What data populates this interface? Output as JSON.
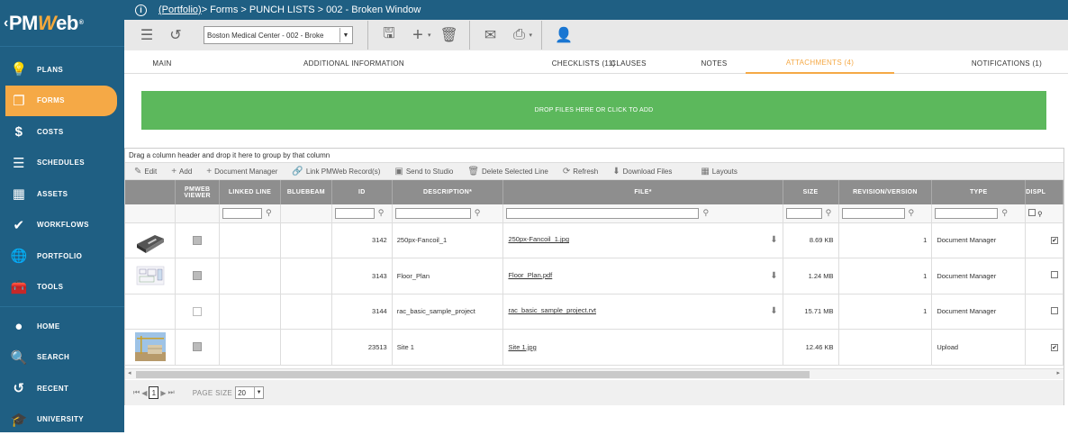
{
  "sidebar": {
    "logo": "PMWeb",
    "items": [
      {
        "label": "PLANS",
        "icon": "lightbulb-icon",
        "active": false
      },
      {
        "label": "FORMS",
        "icon": "forms-icon",
        "active": true
      },
      {
        "label": "COSTS",
        "icon": "dollar-icon",
        "active": false
      },
      {
        "label": "SCHEDULES",
        "icon": "schedule-icon",
        "active": false
      },
      {
        "label": "ASSETS",
        "icon": "building-icon",
        "active": false
      },
      {
        "label": "WORKFLOWS",
        "icon": "checkmark-icon",
        "active": false
      },
      {
        "label": "PORTFOLIO",
        "icon": "globe-icon",
        "active": false
      },
      {
        "label": "TOOLS",
        "icon": "toolbox-icon",
        "active": false
      },
      {
        "label": "HOME",
        "icon": "avatar-icon",
        "active": false
      },
      {
        "label": "SEARCH",
        "icon": "search-icon",
        "active": false
      },
      {
        "label": "RECENT",
        "icon": "history-icon",
        "active": false
      },
      {
        "label": "UNIVERSITY",
        "icon": "graduation-cap-icon",
        "active": false
      }
    ]
  },
  "breadcrumb": {
    "portfolio": "(Portfolio)",
    "rest": " > Forms > PUNCH LISTS > 002 - Broken Window"
  },
  "toolbar": {
    "record_select": "Boston Medical Center - 002 - Broke"
  },
  "tabs": [
    {
      "label": "MAIN",
      "active": false
    },
    {
      "label": "ADDITIONAL INFORMATION",
      "active": false
    },
    {
      "label": "CHECKLISTS (11)",
      "active": false
    },
    {
      "label": "CLAUSES",
      "active": false
    },
    {
      "label": "NOTES",
      "active": false
    },
    {
      "label": "ATTACHMENTS (4)",
      "active": true
    },
    {
      "label": "NOTIFICATIONS (1)",
      "active": false
    }
  ],
  "dropzone": "DROP FILES HERE OR CLICK TO ADD",
  "grid": {
    "group_hint": "Drag a column header and drop it here to group by that column",
    "actions": [
      "Edit",
      "Add",
      "Document Manager",
      "Link PMWeb Record(s)",
      "Send to Studio",
      "Delete Selected Line",
      "Refresh",
      "Download Files",
      "Layouts"
    ],
    "columns": [
      "",
      "PMWEB VIEWER",
      "LINKED LINE",
      "BLUEBEAM",
      "ID",
      "DESCRIPTION*",
      "FILE*",
      "SIZE",
      "REVISION/VERSION",
      "TYPE",
      "DISPL"
    ],
    "rows": [
      {
        "id": "3142",
        "description": "250px-Fancoil_1",
        "file": "250px-Fancoil_1.jpg",
        "size": "8.69 KB",
        "revision": "1",
        "type": "Document Manager",
        "checked": true,
        "download": true,
        "thumb": "fancoil"
      },
      {
        "id": "3143",
        "description": "Floor_Plan",
        "file": "Floor_Plan.pdf",
        "size": "1.24 MB",
        "revision": "1",
        "type": "Document Manager",
        "checked": false,
        "download": true,
        "thumb": "floorplan"
      },
      {
        "id": "3144",
        "description": "rac_basic_sample_project",
        "file": "rac_basic_sample_project.rvt",
        "size": "15.71 MB",
        "revision": "1",
        "type": "Document Manager",
        "checked": false,
        "download": true,
        "thumb": "none"
      },
      {
        "id": "23513",
        "description": "Site 1",
        "file": "Site 1.jpg",
        "size": "12.46 KB",
        "revision": "",
        "type": "Upload",
        "checked": true,
        "download": false,
        "thumb": "site"
      }
    ]
  },
  "pager": {
    "page": "1",
    "page_size_label": "PAGE SIZE",
    "page_size": "20"
  },
  "colors": {
    "sidebar": "#1f5f83",
    "accent": "#f5a946",
    "dropzone": "#5cb85c"
  }
}
